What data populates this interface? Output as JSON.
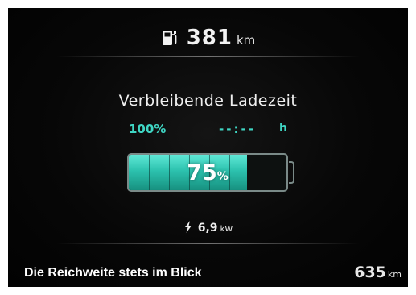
{
  "range": {
    "value": "381",
    "unit": "km",
    "icon": "fuel-pump-icon"
  },
  "charging": {
    "title": "Verbleibende Ladezeit",
    "target_percent": "100%",
    "time_remaining": "--:--",
    "time_unit": "h",
    "battery_level_percent": "75",
    "battery_level_symbol": "%",
    "battery_level_fraction": 0.75
  },
  "power": {
    "value": "6,9",
    "unit": "kW",
    "icon": "lightning-bolt-icon"
  },
  "caption": "Die Reichweite stets im Blick",
  "odometer": {
    "value": "635",
    "unit": "km"
  },
  "colors": {
    "accent": "#3fd6c4",
    "battery_fill": "#2cc2ae",
    "background": "#070707"
  }
}
